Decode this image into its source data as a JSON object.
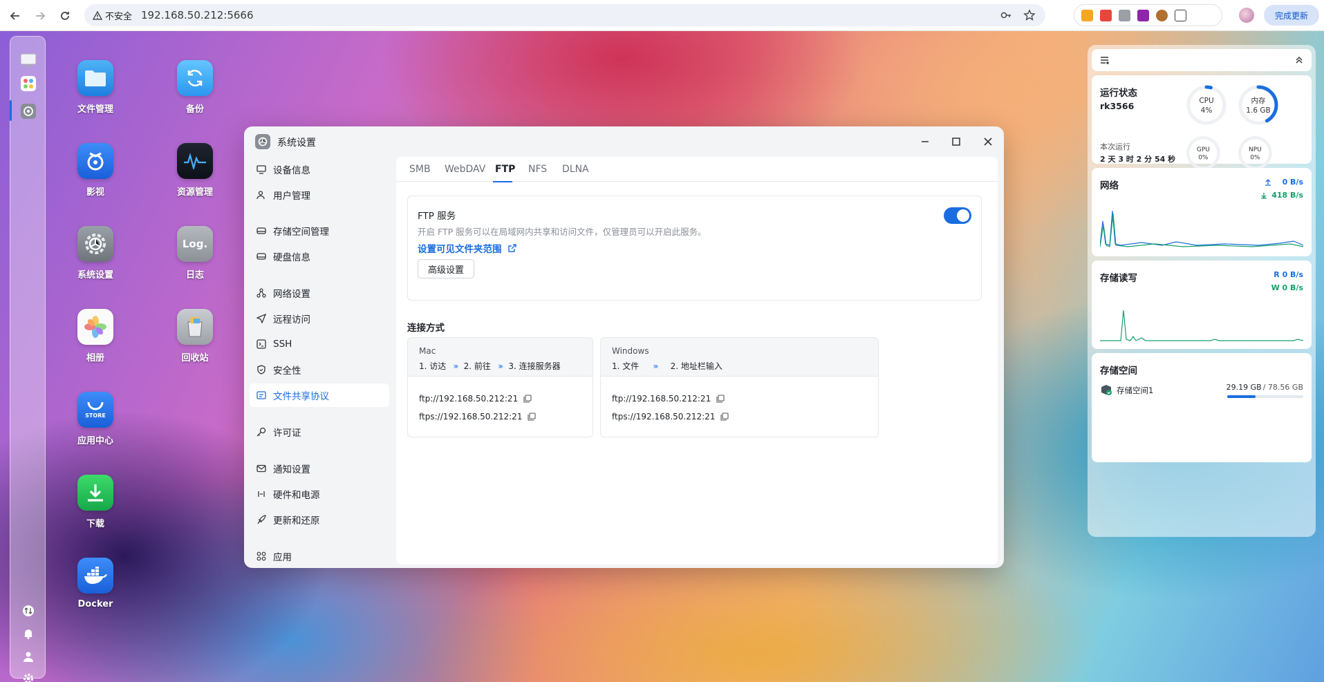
{
  "browser": {
    "security_label": "不安全",
    "url": "192.168.50.212:5666",
    "update_button": "完成更新"
  },
  "desktop": {
    "apps": [
      {
        "label": "文件管理",
        "icon": "folder-icon"
      },
      {
        "label": "备份",
        "icon": "backup-icon"
      },
      {
        "label": "影视",
        "icon": "video-icon"
      },
      {
        "label": "资源管理",
        "icon": "resource-monitor-icon"
      },
      {
        "label": "系统设置",
        "icon": "settings-gear-icon"
      },
      {
        "label": "日志",
        "icon": "log-icon"
      },
      {
        "label": "相册",
        "icon": "photos-icon"
      },
      {
        "label": "回收站",
        "icon": "recycle-bin-icon"
      },
      {
        "label": "应用中心",
        "icon": "app-store-icon"
      },
      {
        "label": "下载",
        "icon": "download-icon"
      },
      {
        "label": "Docker",
        "icon": "docker-icon"
      }
    ],
    "store_text": "STORE",
    "log_text": "Log."
  },
  "window": {
    "title": "系统设置",
    "sidebar": [
      {
        "label": "设备信息",
        "icon": "monitor-icon"
      },
      {
        "label": "用户管理",
        "icon": "users-icon"
      },
      {
        "label": "存储空间管理",
        "icon": "drive-icon"
      },
      {
        "label": "硬盘信息",
        "icon": "disk-icon"
      },
      {
        "label": "网络设置",
        "icon": "network-icon"
      },
      {
        "label": "远程访问",
        "icon": "send-icon"
      },
      {
        "label": "SSH",
        "icon": "terminal-icon"
      },
      {
        "label": "安全性",
        "icon": "shield-icon"
      },
      {
        "label": "文件共享协议",
        "icon": "share-folder-icon",
        "active": true
      },
      {
        "label": "许可证",
        "icon": "key-icon"
      },
      {
        "label": "通知设置",
        "icon": "mail-icon"
      },
      {
        "label": "硬件和电源",
        "icon": "power-icon"
      },
      {
        "label": "更新和还原",
        "icon": "rocket-icon"
      },
      {
        "label": "应用",
        "icon": "apps-grid-icon"
      }
    ],
    "tabs": [
      "SMB",
      "WebDAV",
      "FTP",
      "NFS",
      "DLNA"
    ],
    "active_tab": "FTP",
    "ftp": {
      "title": "FTP 服务",
      "enabled": true,
      "description": "开启 FTP 服务可以在局域网内共享和访问文件，仅管理员可以开启此服务。",
      "folder_link": "设置可见文件夹范围",
      "advanced_button": "高级设置"
    },
    "connection": {
      "heading": "连接方式",
      "mac": {
        "os": "Mac",
        "steps": [
          "1. 访达",
          "2. 前往",
          "3. 连接服务器"
        ],
        "ftp_url": "ftp://192.168.50.212:21",
        "ftps_url": "ftps://192.168.50.212:21"
      },
      "windows": {
        "os": "Windows",
        "steps": [
          "1. 文件",
          "2. 地址栏输入"
        ],
        "ftp_url": "ftp://192.168.50.212:21",
        "ftps_url": "ftps://192.168.50.212:21"
      }
    }
  },
  "widgets": {
    "status": {
      "title": "运行状态",
      "device": "rk3566",
      "uptime_label": "本次运行",
      "uptime": "2 天 3 时 2 分 54 秒",
      "cpu": {
        "label": "CPU",
        "value": "4%",
        "percent": 4
      },
      "memory": {
        "label": "内存",
        "value": "1.6 GB",
        "percent": 42
      },
      "gpu": {
        "label": "GPU",
        "value": "0%",
        "percent": 0
      },
      "npu": {
        "label": "NPU",
        "value": "0%",
        "percent": 0
      }
    },
    "network": {
      "title": "网络",
      "upload": "0 B/s",
      "download": "418 B/s"
    },
    "storage_io": {
      "title": "存储读写",
      "read": "R 0 B/s",
      "write": "W 0 B/s"
    },
    "storage": {
      "title": "存储空间",
      "volume": "存储空间1",
      "used": "29.19 GB",
      "total": "/ 78.56 GB",
      "used_fraction": 0.37
    }
  },
  "colors": {
    "accent": "#1a6de0",
    "upload": "#1a6de0",
    "download": "#14a06a"
  }
}
